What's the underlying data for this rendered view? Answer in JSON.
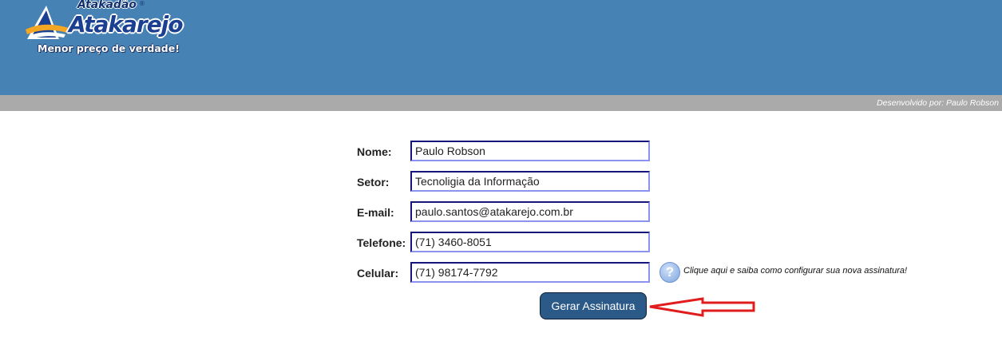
{
  "brand": {
    "small_name": "Atakadão",
    "registered_mark": "®",
    "name": "Atakarejo",
    "tagline": "Menor preço de verdade!"
  },
  "credit": "Desenvolvido por: Paulo Robson",
  "form": {
    "fields": [
      {
        "label": "Nome:",
        "value": "Paulo Robson"
      },
      {
        "label": "Setor:",
        "value": "Tecnoligia da Informação"
      },
      {
        "label": "E-mail:",
        "value": "paulo.santos@atakarejo.com.br"
      },
      {
        "label": "Telefone:",
        "value": "(71) 3460-8051"
      },
      {
        "label": "Celular:",
        "value": "(71) 98174-7792"
      }
    ],
    "help": {
      "icon": "question-icon",
      "glyph": "?",
      "text": "Clique aqui e saiba como configurar sua nova assinatura!"
    },
    "submit_label": "Gerar Assinatura"
  },
  "colors": {
    "header": "#4682b4",
    "credit_bar": "#aaaaaa",
    "button": "#2c5a88",
    "annotation_arrow": "#e01c1c"
  }
}
